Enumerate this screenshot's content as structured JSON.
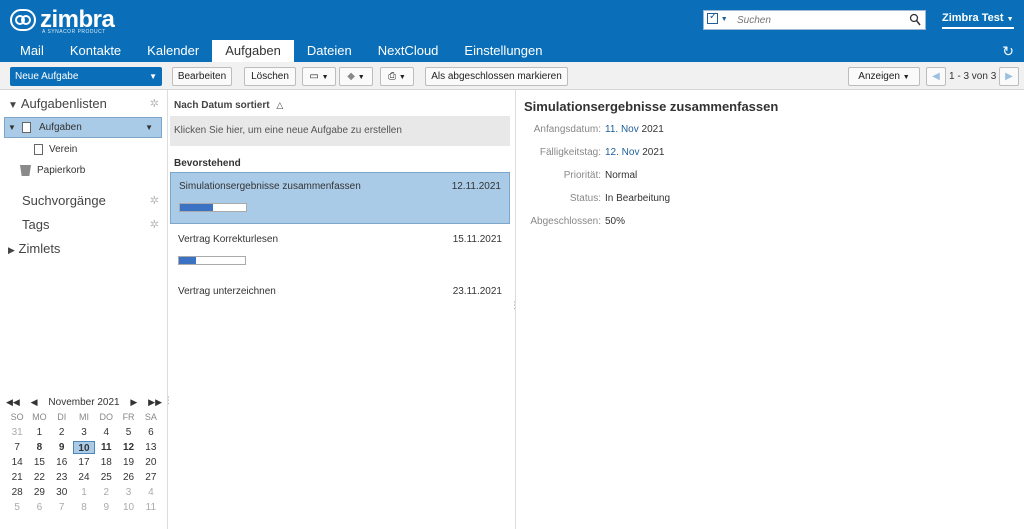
{
  "header": {
    "logo_text": "zimbra",
    "logo_sub": "A SYNACOR PRODUCT",
    "search_placeholder": "Suchen",
    "user_name": "Zimbra Test",
    "tabs": [
      "Mail",
      "Kontakte",
      "Kalender",
      "Aufgaben",
      "Dateien",
      "NextCloud",
      "Einstellungen"
    ],
    "active_tab": "Aufgaben"
  },
  "toolbar": {
    "new_task": "Neue Aufgabe",
    "edit": "Bearbeiten",
    "delete": "Löschen",
    "mark_complete": "Als abgeschlossen markieren",
    "view": "Anzeigen",
    "pagination": "1 - 3 von 3"
  },
  "sidebar": {
    "tasklists_label": "Aufgabenlisten",
    "items": [
      {
        "label": "Aufgaben",
        "selected": true
      },
      {
        "label": "Verein"
      },
      {
        "label": "Papierkorb"
      }
    ],
    "searches_label": "Suchvorgänge",
    "tags_label": "Tags",
    "zimlets_label": "Zimlets"
  },
  "mini_calendar": {
    "month": "November 2021",
    "weekdays": [
      "SO",
      "MO",
      "DI",
      "MI",
      "DO",
      "FR",
      "SA"
    ],
    "weeks": [
      [
        "31",
        "1",
        "2",
        "3",
        "4",
        "5",
        "6"
      ],
      [
        "7",
        "8",
        "9",
        "10",
        "11",
        "12",
        "13"
      ],
      [
        "14",
        "15",
        "16",
        "17",
        "18",
        "19",
        "20"
      ],
      [
        "21",
        "22",
        "23",
        "24",
        "25",
        "26",
        "27"
      ],
      [
        "28",
        "29",
        "30",
        "1",
        "2",
        "3",
        "4"
      ],
      [
        "5",
        "6",
        "7",
        "8",
        "9",
        "10",
        "11"
      ]
    ],
    "today": "10"
  },
  "task_list": {
    "sort_label": "Nach Datum sortiert",
    "create_hint": "Klicken Sie hier, um eine neue Aufgabe zu erstellen",
    "group_label": "Bevorstehend",
    "tasks": [
      {
        "title": "Simulationsergebnisse zusammenfassen",
        "date": "12.11.2021",
        "progress": 0.5,
        "selected": true
      },
      {
        "title": "Vertrag Korrekturlesen",
        "date": "15.11.2021",
        "progress": 0.25
      },
      {
        "title": "Vertrag unterzeichnen",
        "date": "23.11.2021",
        "progress": null
      }
    ]
  },
  "detail": {
    "title": "Simulationsergebnisse zusammenfassen",
    "start_label": "Anfangsdatum:",
    "start_value_day": "11. Nov",
    "start_value_year": "2021",
    "due_label": "Fälligkeitstag:",
    "due_value_day": "12. Nov",
    "due_value_year": "2021",
    "priority_label": "Priorität:",
    "priority_value": "Normal",
    "status_label": "Status:",
    "status_value": "In Bearbeitung",
    "completed_label": "Abgeschlossen:",
    "completed_value": "50%"
  }
}
